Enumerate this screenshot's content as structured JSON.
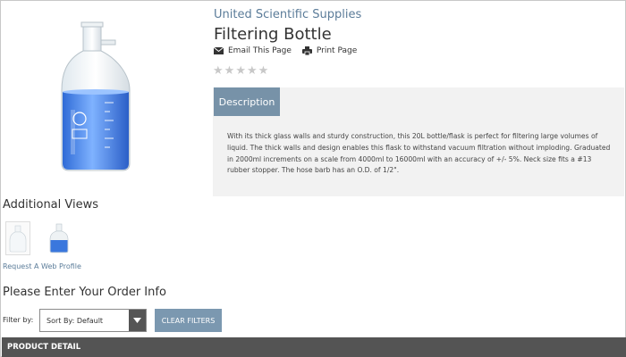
{
  "product": {
    "brand": "United Scientific Supplies",
    "title": "Filtering Bottle",
    "image_icon": "filtering-bottle-image"
  },
  "share": {
    "email_label": "Email This Page",
    "print_label": "Print Page"
  },
  "rating": {
    "stars": [
      "★",
      "★",
      "★",
      "★",
      "★"
    ],
    "filled": 0,
    "color_empty": "#c8c8c8"
  },
  "description": {
    "tab_label": "Description",
    "text": "With its thick glass walls and sturdy construction, this 20L bottle/flask is perfect for filtering large volumes of liquid. The thick walls and design enables this flask to withstand vacuum filtration without imploding. Graduated in 2000ml increments on a scale from 4000ml to 16000ml with an accuracy of +/- 5%. Neck size fits a #13 rubber stopper. The hose barb has an O.D. of 1/2\"."
  },
  "additional_views": {
    "heading": "Additional Views",
    "thumb_count": 2
  },
  "request_link": "Request A Web Profile",
  "order": {
    "heading": "Please Enter Your Order Info",
    "filter_label": "Filter by:",
    "sort_value": "Sort By: Default",
    "clear_label": "CLEAR FILTERS"
  },
  "product_detail_label": "PRODUCT DETAIL",
  "colors": {
    "accent": "#5b7c99",
    "tab": "#7792a8",
    "button": "#7b98b0",
    "bar": "#545454",
    "panel": "#f2f2f2"
  }
}
